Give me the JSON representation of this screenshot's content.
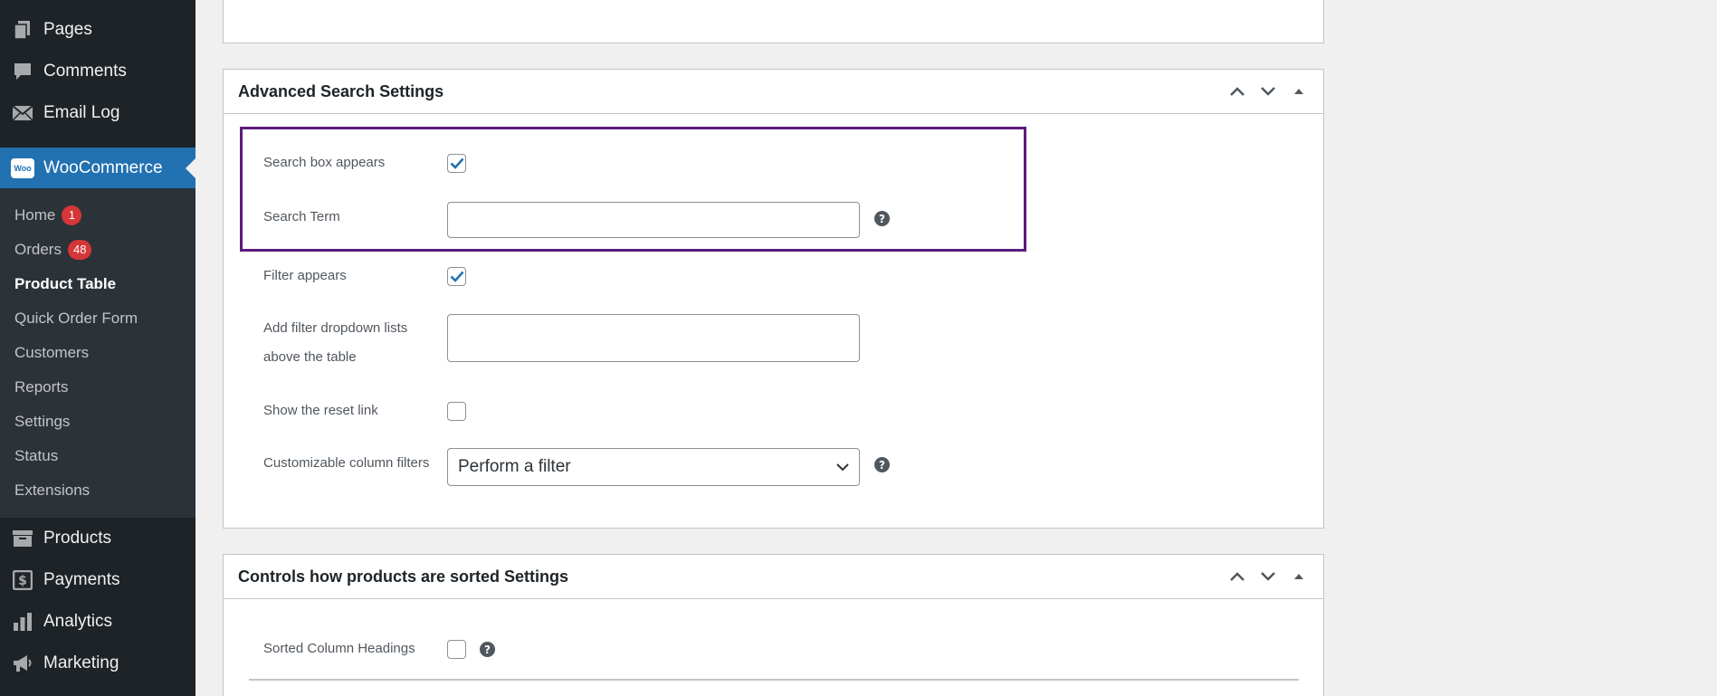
{
  "sidebar": {
    "top_items": [
      {
        "label": "Pages",
        "icon": "pages-icon"
      },
      {
        "label": "Comments",
        "icon": "comments-icon"
      },
      {
        "label": "Email Log",
        "icon": "email-icon"
      }
    ],
    "current": {
      "label": "WooCommerce",
      "icon_text": "Woo"
    },
    "submenu": [
      {
        "label": "Home",
        "badge": "1"
      },
      {
        "label": "Orders",
        "badge": "48"
      },
      {
        "label": "Product Table"
      },
      {
        "label": "Quick Order Form"
      },
      {
        "label": "Customers"
      },
      {
        "label": "Reports"
      },
      {
        "label": "Settings"
      },
      {
        "label": "Status"
      },
      {
        "label": "Extensions"
      }
    ],
    "bottom_items": [
      {
        "label": "Products",
        "icon": "products-icon"
      },
      {
        "label": "Payments",
        "icon": "payments-icon"
      },
      {
        "label": "Analytics",
        "icon": "analytics-icon"
      },
      {
        "label": "Marketing",
        "icon": "marketing-icon"
      }
    ]
  },
  "advanced_search": {
    "title": "Advanced Search Settings",
    "fields": {
      "search_box": {
        "label": "Search box appears",
        "checked": true
      },
      "search_term": {
        "label": "Search Term",
        "value": ""
      },
      "filter_appears": {
        "label": "Filter appears",
        "checked": true
      },
      "filter_dropdowns": {
        "label_line1": "Add filter dropdown lists",
        "label_line2": "above the table",
        "value": ""
      },
      "reset_link": {
        "label": "Show the reset link",
        "checked": false
      },
      "column_filters": {
        "label": "Customizable column filters",
        "selected": "Perform a filter"
      }
    }
  },
  "sorting": {
    "title": "Controls how products are sorted Settings",
    "fields": {
      "sorted_headings": {
        "label": "Sorted Column Headings",
        "checked": false
      }
    }
  },
  "help_glyph": "?",
  "colors": {
    "accent": "#2271b1",
    "highlight": "#5b1c7d",
    "badge": "#d63638"
  }
}
